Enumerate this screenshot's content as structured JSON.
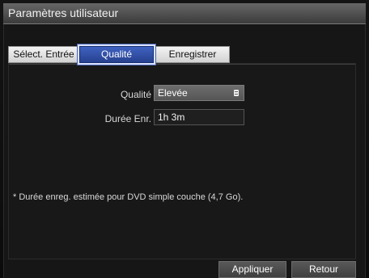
{
  "window": {
    "title": "Paramètres utilisateur"
  },
  "tabs": [
    {
      "label": "Sélect. Entrée",
      "selected": false
    },
    {
      "label": "Qualité",
      "selected": true
    },
    {
      "label": "Enregistrer",
      "selected": false
    }
  ],
  "settings": {
    "quality": {
      "label": "Qualité",
      "value": "Elevée",
      "icon": "dropdown-icon"
    },
    "duration": {
      "label": "Durée Enr.",
      "value": "1h 3m"
    },
    "note": "* Durée enreg. estimée pour DVD simple couche (4,7 Go)."
  },
  "footer": {
    "apply_label": "Appliquer",
    "back_label": "Retour"
  },
  "colors": {
    "selected_tab": "#2f4ea8",
    "selected_tab_outline": "#dbe3ff",
    "title_bar": "#4a4a4a",
    "panel_background": "#181818"
  }
}
